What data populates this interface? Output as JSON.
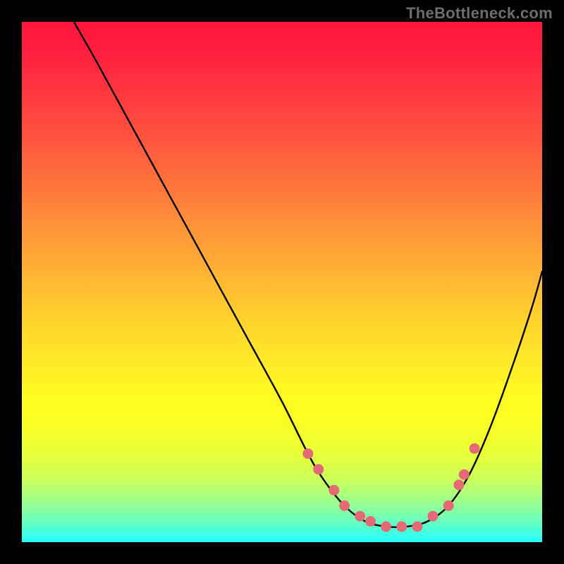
{
  "watermark": "TheBottleneck.com",
  "chart_data": {
    "type": "line",
    "title": "",
    "xlabel": "",
    "ylabel": "",
    "xlim": [
      0,
      100
    ],
    "ylim": [
      0,
      100
    ],
    "series": [
      {
        "name": "bottleneck-curve",
        "x": [
          10,
          14,
          20,
          26,
          32,
          38,
          44,
          50,
          55,
          58,
          62,
          66,
          70,
          74,
          78,
          82,
          86,
          90,
          94,
          98,
          100
        ],
        "y": [
          100,
          93,
          82,
          71,
          60,
          49,
          38,
          27,
          17,
          12,
          7,
          4,
          3,
          3,
          4,
          7,
          13,
          22,
          33,
          45,
          52
        ]
      }
    ],
    "markers": {
      "name": "highlight-points",
      "color": "#e46a75",
      "x": [
        55,
        57,
        60,
        62,
        65,
        67,
        70,
        73,
        76,
        79,
        82,
        84,
        85,
        87
      ],
      "y": [
        17,
        14,
        10,
        7,
        5,
        4,
        3,
        3,
        3,
        5,
        7,
        11,
        13,
        18
      ]
    }
  }
}
